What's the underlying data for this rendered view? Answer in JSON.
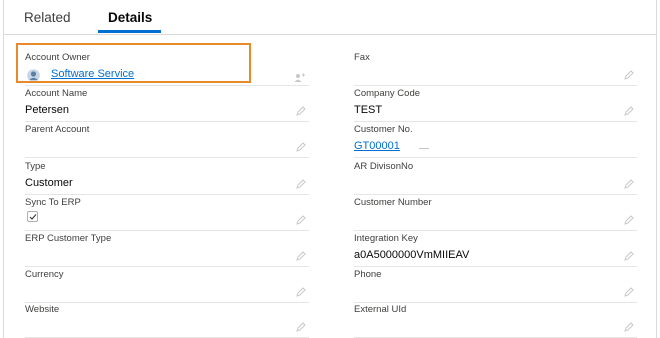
{
  "tabs": [
    {
      "label": "Related"
    },
    {
      "label": "Details"
    }
  ],
  "fields": {
    "account_owner": {
      "label": "Account Owner",
      "value": "Software Service"
    },
    "fax": {
      "label": "Fax",
      "value": ""
    },
    "account_name": {
      "label": "Account Name",
      "value": "Petersen"
    },
    "company_code": {
      "label": "Company Code",
      "value": "TEST"
    },
    "parent_account": {
      "label": "Parent Account",
      "value": ""
    },
    "customer_no": {
      "label": "Customer No.",
      "value": "GT00001"
    },
    "type": {
      "label": "Type",
      "value": "Customer"
    },
    "ar_divison_no": {
      "label": "AR DivisonNo",
      "value": ""
    },
    "sync_to_erp": {
      "label": "Sync To ERP",
      "checked": true
    },
    "customer_number": {
      "label": "Customer Number",
      "value": ""
    },
    "erp_customer_type": {
      "label": "ERP Customer Type",
      "value": ""
    },
    "integration_key": {
      "label": "Integration Key",
      "value": "a0A5000000VmMIIEAV"
    },
    "currency": {
      "label": "Currency",
      "value": ""
    },
    "phone": {
      "label": "Phone",
      "value": ""
    },
    "website": {
      "label": "Website",
      "value": ""
    },
    "external_uid": {
      "label": "External UId",
      "value": ""
    }
  },
  "colors": {
    "accent": "#0070d2",
    "highlight_border": "#e8892a",
    "label": "#3e3e3c",
    "value": "#080707"
  },
  "icons": [
    "user-avatar-icon",
    "pencil-icon",
    "change-owner-icon",
    "checkmark-icon"
  ]
}
